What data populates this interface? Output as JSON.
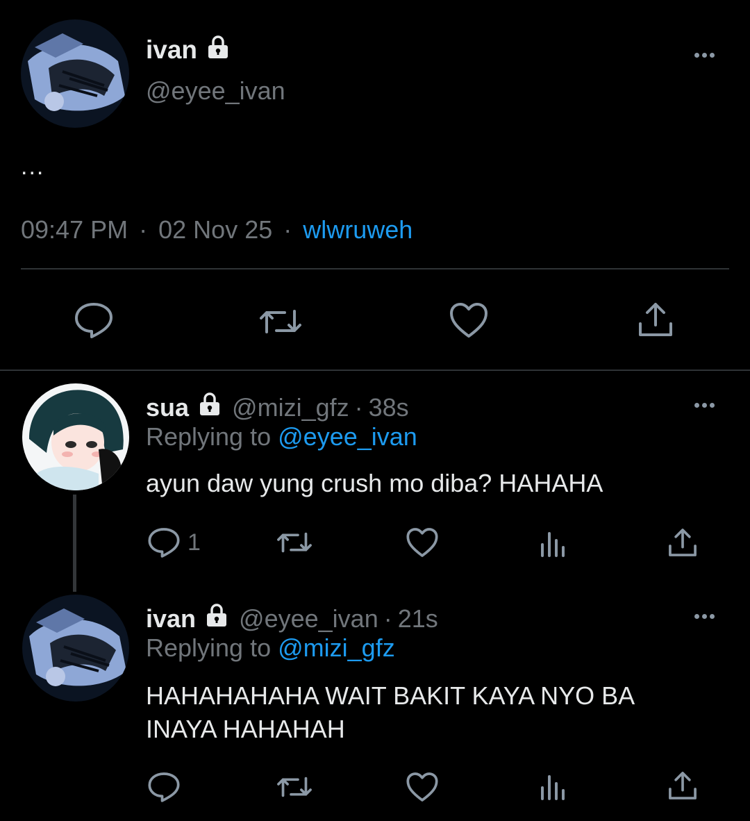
{
  "main_tweet": {
    "display_name": "ivan",
    "handle": "@eyee_ivan",
    "text": "...",
    "time": "09:47 PM",
    "separator": "·",
    "date": "02 Nov 25",
    "source": "wlwruweh"
  },
  "replies": [
    {
      "display_name": "sua",
      "handle": "@mizi_gfz",
      "separator": "·",
      "age": "38s",
      "replying_label": "Replying to",
      "replying_to": "@eyee_ivan",
      "text": "ayun daw yung crush mo diba? HAHAHA",
      "reply_count": "1"
    },
    {
      "display_name": "ivan",
      "handle": "@eyee_ivan",
      "separator": "·",
      "age": "21s",
      "replying_label": "Replying to",
      "replying_to": "@mizi_gfz",
      "text_line1": "HAHAHAHAHA WAIT BAKIT KAYA NYO BA",
      "text_line2": "INAYA HAHAHAH",
      "reply_count": ""
    }
  ],
  "icons": {
    "lock": "lock-icon",
    "more": "more-icon",
    "reply": "reply-icon",
    "retweet": "retweet-icon",
    "like": "like-icon",
    "views": "analytics-icon",
    "share": "share-icon"
  },
  "colors": {
    "background": "#000000",
    "text": "#e7e9ea",
    "muted": "#71767b",
    "accent": "#1d9bf0",
    "icon": "#8b98a5"
  }
}
